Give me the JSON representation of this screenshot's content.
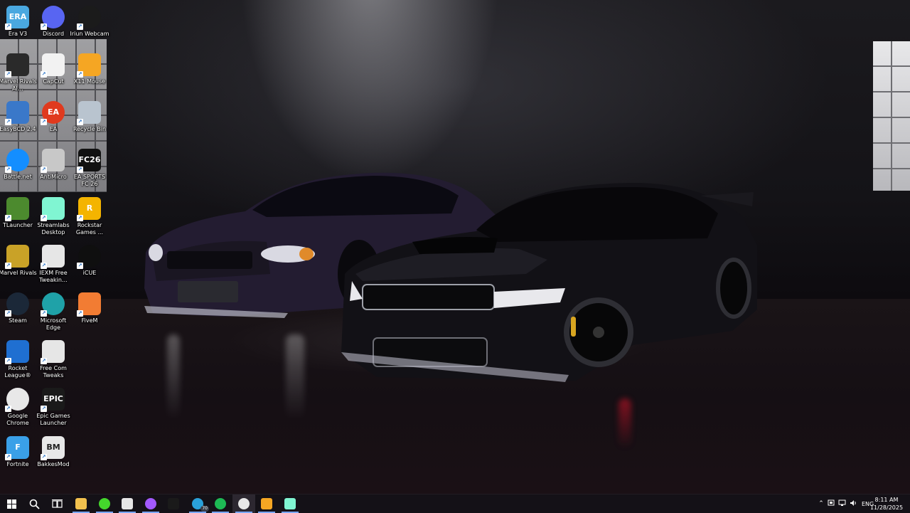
{
  "desktop": {
    "icons": [
      {
        "id": "era-v3",
        "label": "Era V3",
        "color": "#4aa8e0",
        "text": "ERA",
        "col": 0,
        "row": 0
      },
      {
        "id": "discord",
        "label": "Discord",
        "color": "#5865f2",
        "text": "",
        "col": 1,
        "row": 0
      },
      {
        "id": "iriun-webcam",
        "label": "Iriun Webcam",
        "color": "#1b1b1b",
        "text": "",
        "col": 2,
        "row": 0
      },
      {
        "id": "marvel-rivals-ai",
        "label": "Marvel Rivals AI…",
        "color": "#2a2a2a",
        "text": "",
        "col": 0,
        "row": 1
      },
      {
        "id": "capcut",
        "label": "CapCut",
        "color": "#f2f2f2",
        "text": "",
        "col": 1,
        "row": 1
      },
      {
        "id": "x11-mouse",
        "label": "X11 Mouse",
        "color": "#f5a623",
        "text": "",
        "col": 2,
        "row": 1
      },
      {
        "id": "easybcd",
        "label": "EasyBCD 2.4",
        "color": "#3a78c9",
        "text": "",
        "col": 0,
        "row": 2
      },
      {
        "id": "ea",
        "label": "EA",
        "color": "#e03a1e",
        "text": "EA",
        "col": 1,
        "row": 2
      },
      {
        "id": "recycle-bin",
        "label": "Recycle Bin",
        "color": "#b9c4cf",
        "text": "",
        "col": 2,
        "row": 2
      },
      {
        "id": "battle-net",
        "label": "Battle.net",
        "color": "#148eff",
        "text": "",
        "col": 0,
        "row": 3
      },
      {
        "id": "antimicro",
        "label": "AntiMicro",
        "color": "#c8c8c8",
        "text": "",
        "col": 1,
        "row": 3
      },
      {
        "id": "ea-sports-fc-26",
        "label": "EA SPORTS FC 26",
        "color": "#111111",
        "text": "FC26",
        "col": 2,
        "row": 3
      },
      {
        "id": "tlauncher",
        "label": "TLauncher",
        "color": "#4c8a2e",
        "text": "",
        "col": 0,
        "row": 4
      },
      {
        "id": "streamlabs-desktop",
        "label": "Streamlabs Desktop",
        "color": "#80f5d2",
        "text": "",
        "col": 1,
        "row": 4
      },
      {
        "id": "rockstar-games",
        "label": "Rockstar Games ...",
        "color": "#f4b400",
        "text": "R",
        "col": 2,
        "row": 4
      },
      {
        "id": "marvel-rivals",
        "label": "Marvel Rivals",
        "color": "#c9a227",
        "text": "",
        "col": 0,
        "row": 5
      },
      {
        "id": "iexm-free-tweaking",
        "label": "IEXM Free Tweakin…",
        "color": "#e6e6e6",
        "text": "",
        "col": 1,
        "row": 5
      },
      {
        "id": "icue",
        "label": "iCUE",
        "color": "#0f0f0f",
        "text": "",
        "col": 2,
        "row": 5
      },
      {
        "id": "steam",
        "label": "Steam",
        "color": "#1b2838",
        "text": "",
        "col": 0,
        "row": 6
      },
      {
        "id": "microsoft-edge",
        "label": "Microsoft Edge",
        "color": "#1fa2a8",
        "text": "",
        "col": 1,
        "row": 6
      },
      {
        "id": "fivem",
        "label": "FiveM",
        "color": "#f27c33",
        "text": "",
        "col": 2,
        "row": 6
      },
      {
        "id": "rocket-league",
        "label": "Rocket League®",
        "color": "#1f6fd1",
        "text": "",
        "col": 0,
        "row": 7
      },
      {
        "id": "free-com-tweaks",
        "label": "Free Com Tweaks",
        "color": "#e6e6e6",
        "text": "",
        "col": 1,
        "row": 7
      },
      {
        "id": "google-chrome",
        "label": "Google Chrome",
        "color": "#e8e8e8",
        "text": "",
        "col": 0,
        "row": 8
      },
      {
        "id": "epic-games-launcher",
        "label": "Epic Games Launcher",
        "color": "#1a1a1a",
        "text": "EPIC",
        "col": 1,
        "row": 8
      },
      {
        "id": "fortnite",
        "label": "Fortnite",
        "color": "#3aa0e8",
        "text": "F",
        "col": 0,
        "row": 9
      },
      {
        "id": "bakkesmod",
        "label": "BakkesMod",
        "color": "#e8e8e8",
        "text": "BM",
        "col": 1,
        "row": 9
      }
    ]
  },
  "taskbar": {
    "items": [
      {
        "id": "start",
        "icon": "windows-start-icon"
      },
      {
        "id": "search",
        "icon": "search-icon"
      },
      {
        "id": "task-view",
        "icon": "task-view-icon"
      },
      {
        "id": "file-explorer",
        "icon": "folder-icon",
        "color": "#f2c14e"
      },
      {
        "id": "razer",
        "icon": "razer-icon",
        "color": "#44d62c"
      },
      {
        "id": "calendar-app",
        "icon": "calendar-icon",
        "color": "#e6e6e6"
      },
      {
        "id": "messenger",
        "icon": "messenger-icon",
        "color": "#a259ff"
      },
      {
        "id": "epic",
        "icon": "epic-games-icon",
        "color": "#1a1a1a"
      },
      {
        "id": "telegram",
        "icon": "telegram-icon",
        "color": "#2aa1da",
        "badge": "70"
      },
      {
        "id": "spotify",
        "icon": "spotify-icon",
        "color": "#1db954"
      },
      {
        "id": "chrome",
        "icon": "chrome-icon",
        "color": "#e8e8e8"
      },
      {
        "id": "x11-mouse",
        "icon": "x11-mouse-icon",
        "color": "#f5a623"
      },
      {
        "id": "streamlabs",
        "icon": "streamlabs-icon",
        "color": "#80f5d2"
      }
    ],
    "tray": {
      "language": "ENG",
      "time": "8:11 AM",
      "date": "11/28/2025"
    }
  }
}
